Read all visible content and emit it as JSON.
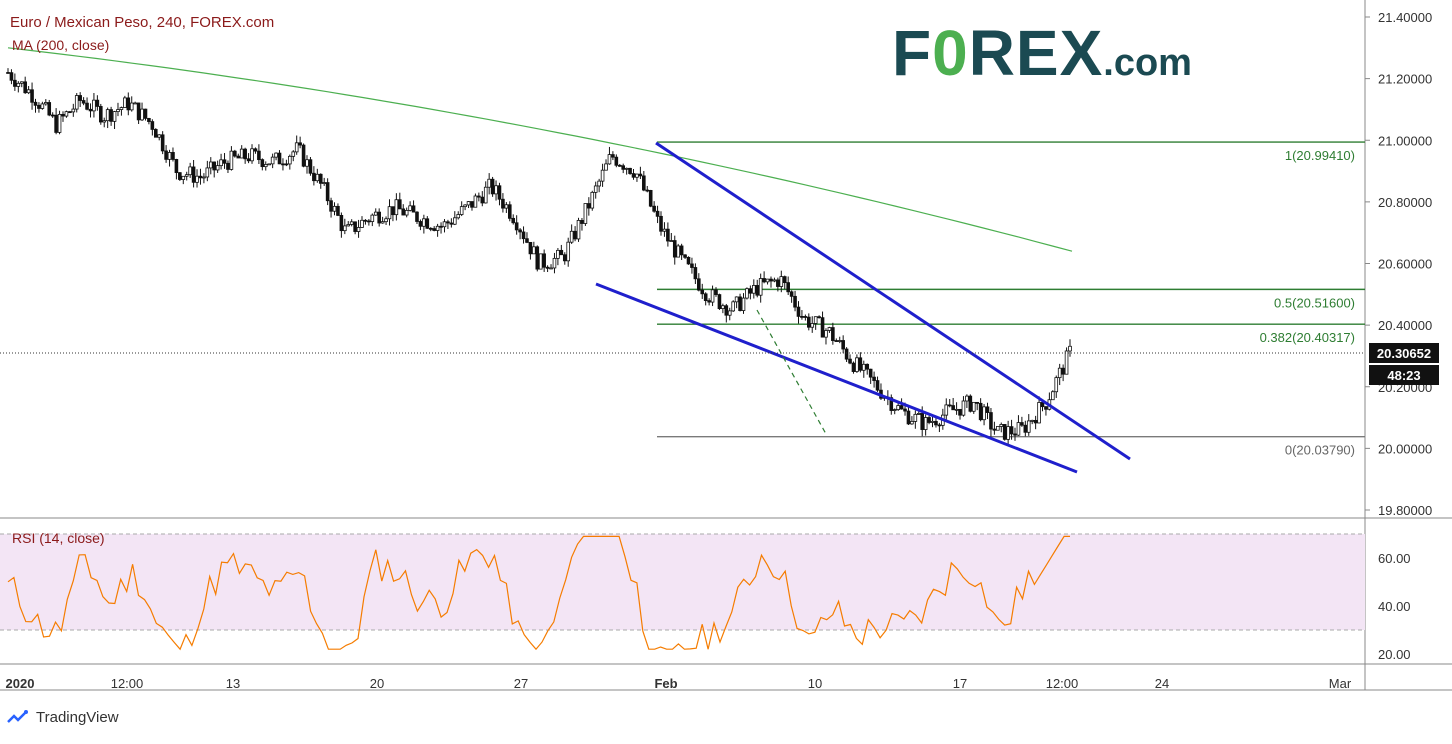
{
  "header": {
    "title": "Euro / Mexican Peso, 240, FOREX.com",
    "ma_label": "MA (200, close)",
    "rsi_label": "RSI (14, close)"
  },
  "logo": {
    "main": "F",
    "accent": "0",
    "rest": "REX",
    "suffix": ".com"
  },
  "watermark": "TradingView",
  "current_price": "20.30652",
  "countdown": "48:23",
  "colors": {
    "candle": "#111111",
    "ma": "#4caf50",
    "fib": "#2e7d32",
    "fib_zero": "#7a7a7a",
    "trendline": "#1f1fcc",
    "rsi": "#f57c00",
    "rsi_band": "#f3e5f5",
    "logo": "#1b4a52",
    "logo_accent": "#4caf50"
  },
  "chart_data": [
    {
      "type": "candlestick",
      "series": [
        {
          "name": "Euro / Mexican Peso, 240, FOREX.com",
          "close_path": [
            {
              "x": "2020-01-01",
              "y": 21.22
            },
            {
              "x": "2020-01-02",
              "y": 21.15
            },
            {
              "x": "2020-01-03",
              "y": 21.05
            },
            {
              "x": "2020-01-06",
              "y": 21.13
            },
            {
              "x": "2020-01-07",
              "y": 21.08
            },
            {
              "x": "2020-01-08",
              "y": 21.12
            },
            {
              "x": "2020-01-09",
              "y": 21.05
            },
            {
              "x": "2020-01-10",
              "y": 20.9
            },
            {
              "x": "2020-01-13",
              "y": 20.88
            },
            {
              "x": "2020-01-14",
              "y": 20.93
            },
            {
              "x": "2020-01-15",
              "y": 20.95
            },
            {
              "x": "2020-01-16",
              "y": 20.93
            },
            {
              "x": "2020-01-17",
              "y": 20.97
            },
            {
              "x": "2020-01-18",
              "y": 20.85
            },
            {
              "x": "2020-01-20",
              "y": 20.7
            },
            {
              "x": "2020-01-21",
              "y": 20.75
            },
            {
              "x": "2020-01-22",
              "y": 20.78
            },
            {
              "x": "2020-01-23",
              "y": 20.75
            },
            {
              "x": "2020-01-24",
              "y": 20.72
            },
            {
              "x": "2020-01-27",
              "y": 20.78
            },
            {
              "x": "2020-01-28",
              "y": 20.85
            },
            {
              "x": "2020-01-29",
              "y": 20.75
            },
            {
              "x": "2020-01-30",
              "y": 20.6
            },
            {
              "x": "2020-01-31",
              "y": 20.62
            },
            {
              "x": "2020-02-01",
              "y": 20.78
            },
            {
              "x": "2020-02-02",
              "y": 20.95
            },
            {
              "x": "2020-02-03",
              "y": 20.9
            },
            {
              "x": "2020-02-04",
              "y": 20.72
            },
            {
              "x": "2020-02-05",
              "y": 20.6
            },
            {
              "x": "2020-02-06",
              "y": 20.5
            },
            {
              "x": "2020-02-07",
              "y": 20.45
            },
            {
              "x": "2020-02-08",
              "y": 20.52
            },
            {
              "x": "2020-02-10",
              "y": 20.55
            },
            {
              "x": "2020-02-11",
              "y": 20.42
            },
            {
              "x": "2020-02-12",
              "y": 20.38
            },
            {
              "x": "2020-02-13",
              "y": 20.28
            },
            {
              "x": "2020-02-14",
              "y": 20.2
            },
            {
              "x": "2020-02-16",
              "y": 20.12
            },
            {
              "x": "2020-02-17",
              "y": 20.08
            },
            {
              "x": "2020-02-18",
              "y": 20.12
            },
            {
              "x": "2020-02-19",
              "y": 20.15
            },
            {
              "x": "2020-02-20",
              "y": 20.05
            },
            {
              "x": "2020-02-21",
              "y": 20.06
            },
            {
              "x": "2020-02-21 08:00",
              "y": 20.15
            },
            {
              "x": "2020-02-21 12:00",
              "y": 20.31
            }
          ]
        }
      ],
      "ma_200": {
        "name": "MA (200, close)",
        "start": {
          "x": "2020-01-01",
          "y": 21.3
        },
        "end": {
          "x": "2020-02-21 12:00",
          "y": 20.64
        }
      },
      "fibonacci": [
        {
          "level": "1",
          "value": 20.9941,
          "label": "1(20.99410)"
        },
        {
          "level": "0.5",
          "value": 20.516,
          "label": "0.5(20.51600)"
        },
        {
          "level": "0.382",
          "value": 20.40317,
          "label": "0.382(20.40317)"
        },
        {
          "level": "0",
          "value": 20.0379,
          "label": "0(20.03790)"
        }
      ],
      "ylim": [
        19.8,
        21.4
      ],
      "y_ticks": [
        "21.40000",
        "21.20000",
        "21.00000",
        "20.80000",
        "20.60000",
        "20.40000",
        "20.20000",
        "20.00000",
        "19.80000"
      ],
      "x_ticks": [
        "2020",
        "12:00",
        "13",
        "20",
        "27",
        "Feb",
        "10",
        "17",
        "12:00",
        "24",
        "Mar"
      ],
      "grid": false,
      "legend": "top-left"
    },
    {
      "type": "line",
      "series": [
        {
          "name": "RSI (14, close)"
        }
      ],
      "ylim": [
        15,
        75
      ],
      "y_ticks": [
        "60.00",
        "40.00",
        "20.00"
      ],
      "band": [
        30,
        70
      ]
    }
  ]
}
